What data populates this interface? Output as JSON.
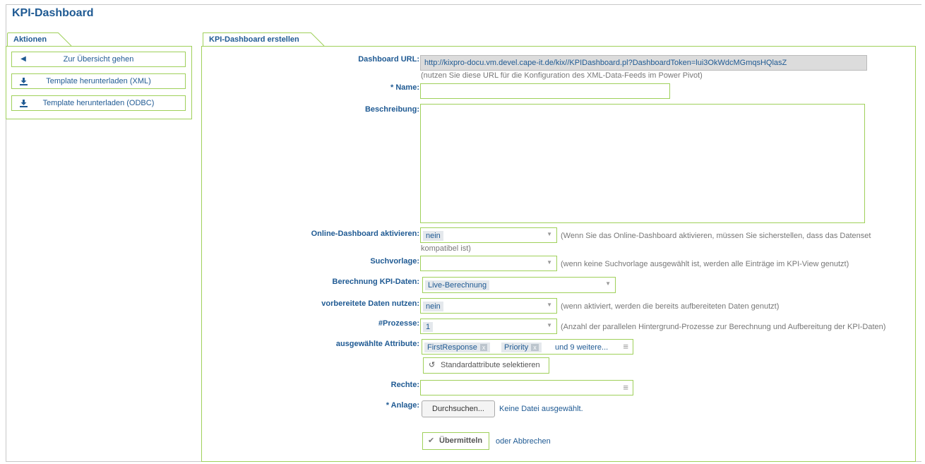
{
  "page": {
    "title": "KPI-Dashboard"
  },
  "left": {
    "tab": "Aktionen",
    "buttons": [
      {
        "label": "Zur Übersicht gehen",
        "icon": "caret-left-icon"
      },
      {
        "label": "Template herunterladen (XML)",
        "icon": "download-icon"
      },
      {
        "label": "Template herunterladen (ODBC)",
        "icon": "download-icon"
      }
    ]
  },
  "form": {
    "tab": "KPI-Dashboard erstellen",
    "dashboard_url": {
      "label": "Dashboard URL:",
      "value": "http://kixpro-docu.vm.devel.cape-it.de/kix//KPIDashboard.pl?DashboardToken=lui3OkWdcMGmqsHQlasZ",
      "hint": "(nutzen Sie diese URL für die Konfiguration des XML-Data-Feeds im Power Pivot)"
    },
    "name": {
      "label": "* Name:",
      "value": ""
    },
    "description": {
      "label": "Beschreibung:",
      "value": ""
    },
    "online_dashboard": {
      "label": "Online-Dashboard aktivieren:",
      "value": "nein",
      "hint": "(Wenn Sie das Online-Dashboard aktivieren, müssen Sie sicherstellen, dass das Datenset",
      "hint2": "kompatibel ist)"
    },
    "search_template": {
      "label": "Suchvorlage:",
      "value": "",
      "hint": "(wenn keine Suchvorlage ausgewählt ist, werden alle Einträge im KPI-View genutzt)"
    },
    "calc_kpi": {
      "label": "Berechnung KPI-Daten:",
      "value": "Live-Berechnung"
    },
    "prepared_data": {
      "label": "vorbereitete Daten nutzen:",
      "value": "nein",
      "hint": "(wenn aktiviert, werden die bereits aufbereiteten Daten genutzt)"
    },
    "processes": {
      "label": "#Prozesse:",
      "value": "1",
      "hint": "(Anzahl der parallelen Hintergrund-Prozesse zur Berechnung und Aufbereitung der KPI-Daten)"
    },
    "attributes": {
      "label": "ausgewählte Attribute:",
      "chips": [
        "FirstResponse",
        "Priority"
      ],
      "remove_glyph": "x",
      "more": "und 9 weitere...",
      "default_button": "Standardattribute selektieren"
    },
    "rights": {
      "label": "Rechte:",
      "value": ""
    },
    "attachment": {
      "label": "* Anlage:",
      "browse_button": "Durchsuchen...",
      "status": "Keine Datei ausgewählt."
    },
    "submit": {
      "label": "Übermitteln",
      "or_text": "oder",
      "cancel": "Abbrechen"
    }
  },
  "colors": {
    "accent_green": "#9fd05a",
    "title_blue": "#1f5a93",
    "url_field_bg": "#dcdcdc"
  }
}
